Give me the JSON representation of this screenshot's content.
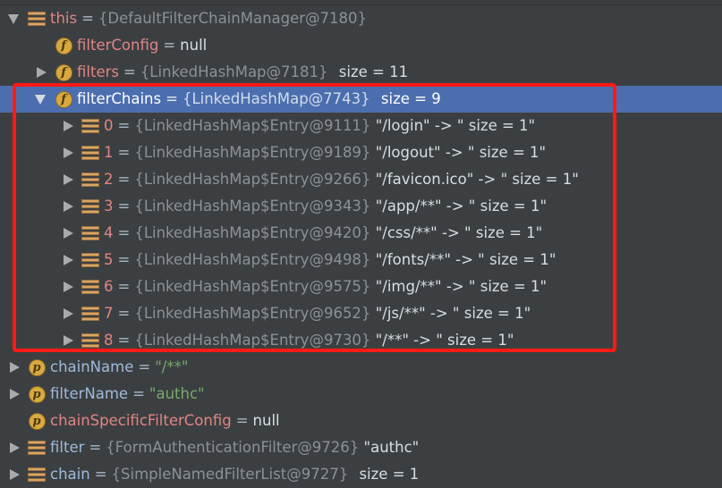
{
  "panel": {
    "title": "Debugger Variables",
    "background_color": "#3c3f41",
    "selection_color": "#4b6eaf",
    "annotation_color": "#ff1a16"
  },
  "icons": {
    "array": "array-stripes-icon",
    "field": "f",
    "parameter": "p",
    "expanded": "chevron-down-icon",
    "collapsed": "chevron-right-icon"
  },
  "rows": [
    {
      "indent": 0,
      "toggle": "expanded",
      "icon": "array",
      "name": "this",
      "eq": "=",
      "type": "{DefaultFilterChainManager@7180}",
      "value": "",
      "size": "",
      "selected": false,
      "name_kind": "field"
    },
    {
      "indent": 1,
      "toggle": "none",
      "icon": "field",
      "name": "filterConfig",
      "eq": "=",
      "type": "",
      "value": "null",
      "size": "",
      "selected": false,
      "name_kind": "field"
    },
    {
      "indent": 1,
      "toggle": "collapsed",
      "icon": "field",
      "name": "filters",
      "eq": "=",
      "type": "{LinkedHashMap@7181}",
      "value": "",
      "size": "size = 11",
      "selected": false,
      "name_kind": "field"
    },
    {
      "indent": 1,
      "toggle": "expanded",
      "icon": "field",
      "name": "filterChains",
      "eq": "=",
      "type": "{LinkedHashMap@7743}",
      "value": "",
      "size": "size = 9",
      "selected": true,
      "name_kind": "field"
    },
    {
      "indent": 2,
      "toggle": "collapsed",
      "icon": "array",
      "name": "0",
      "eq": "=",
      "type": "{LinkedHashMap$Entry@9111}",
      "value": "\"/login\" -> \" size = 1\"",
      "size": "",
      "selected": false,
      "name_kind": "field"
    },
    {
      "indent": 2,
      "toggle": "collapsed",
      "icon": "array",
      "name": "1",
      "eq": "=",
      "type": "{LinkedHashMap$Entry@9189}",
      "value": "\"/logout\" -> \" size = 1\"",
      "size": "",
      "selected": false,
      "name_kind": "field"
    },
    {
      "indent": 2,
      "toggle": "collapsed",
      "icon": "array",
      "name": "2",
      "eq": "=",
      "type": "{LinkedHashMap$Entry@9266}",
      "value": "\"/favicon.ico\" -> \" size = 1\"",
      "size": "",
      "selected": false,
      "name_kind": "field"
    },
    {
      "indent": 2,
      "toggle": "collapsed",
      "icon": "array",
      "name": "3",
      "eq": "=",
      "type": "{LinkedHashMap$Entry@9343}",
      "value": "\"/app/**\" -> \" size = 1\"",
      "size": "",
      "selected": false,
      "name_kind": "field"
    },
    {
      "indent": 2,
      "toggle": "collapsed",
      "icon": "array",
      "name": "4",
      "eq": "=",
      "type": "{LinkedHashMap$Entry@9420}",
      "value": "\"/css/**\" -> \" size = 1\"",
      "size": "",
      "selected": false,
      "name_kind": "field"
    },
    {
      "indent": 2,
      "toggle": "collapsed",
      "icon": "array",
      "name": "5",
      "eq": "=",
      "type": "{LinkedHashMap$Entry@9498}",
      "value": "\"/fonts/**\" -> \" size = 1\"",
      "size": "",
      "selected": false,
      "name_kind": "field"
    },
    {
      "indent": 2,
      "toggle": "collapsed",
      "icon": "array",
      "name": "6",
      "eq": "=",
      "type": "{LinkedHashMap$Entry@9575}",
      "value": "\"/img/**\" -> \" size = 1\"",
      "size": "",
      "selected": false,
      "name_kind": "field"
    },
    {
      "indent": 2,
      "toggle": "collapsed",
      "icon": "array",
      "name": "7",
      "eq": "=",
      "type": "{LinkedHashMap$Entry@9652}",
      "value": "\"/js/**\" -> \" size = 1\"",
      "size": "",
      "selected": false,
      "name_kind": "field"
    },
    {
      "indent": 2,
      "toggle": "collapsed",
      "icon": "array",
      "name": "8",
      "eq": "=",
      "type": "{LinkedHashMap$Entry@9730}",
      "value": "\"/**\" -> \" size = 1\"",
      "size": "",
      "selected": false,
      "name_kind": "field"
    },
    {
      "indent": 0,
      "toggle": "collapsed",
      "icon": "parameter",
      "name": "chainName",
      "eq": "=",
      "type": "",
      "value": "\"/**\"",
      "size": "",
      "selected": false,
      "name_kind": "var",
      "value_style": "green"
    },
    {
      "indent": 0,
      "toggle": "collapsed",
      "icon": "parameter",
      "name": "filterName",
      "eq": "=",
      "type": "",
      "value": "\"authc\"",
      "size": "",
      "selected": false,
      "name_kind": "var",
      "value_style": "green"
    },
    {
      "indent": 0,
      "toggle": "none",
      "icon": "parameter",
      "name": "chainSpecificFilterConfig",
      "eq": "=",
      "type": "",
      "value": "null",
      "size": "",
      "selected": false,
      "name_kind": "field"
    },
    {
      "indent": 0,
      "toggle": "collapsed",
      "icon": "array",
      "name": "filter",
      "eq": "=",
      "type": "{FormAuthenticationFilter@9726}",
      "value": "\"authc\"",
      "size": "",
      "selected": false,
      "name_kind": "var"
    },
    {
      "indent": 0,
      "toggle": "collapsed",
      "icon": "array",
      "name": "chain",
      "eq": "=",
      "type": "{SimpleNamedFilterList@9727}",
      "value": "",
      "size": "size = 1",
      "selected": false,
      "name_kind": "var"
    }
  ]
}
